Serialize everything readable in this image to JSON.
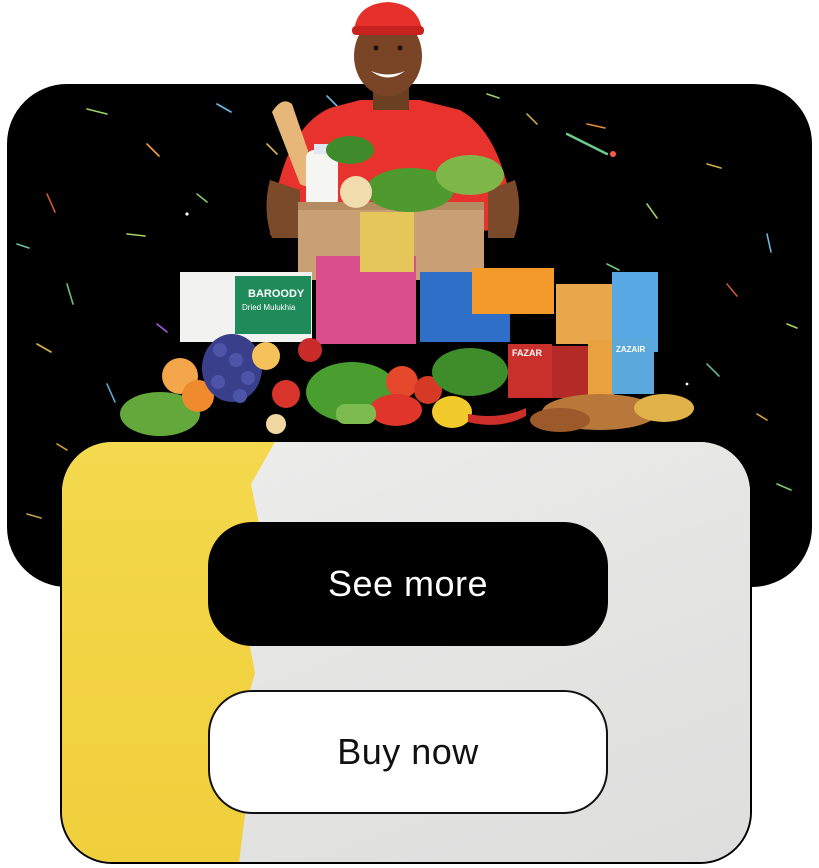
{
  "hero": {
    "background_color": "#000000",
    "illustration": "delivery-person-with-groceries",
    "product_labels": [
      "BAROODY",
      "Dried Mulukhia",
      "ZAZAIR",
      "FAZAR"
    ]
  },
  "card": {
    "left_color": "#f2d444",
    "right_color": "#e6e6e5"
  },
  "buttons": {
    "see_more_label": "See more",
    "buy_now_label": "Buy now"
  }
}
